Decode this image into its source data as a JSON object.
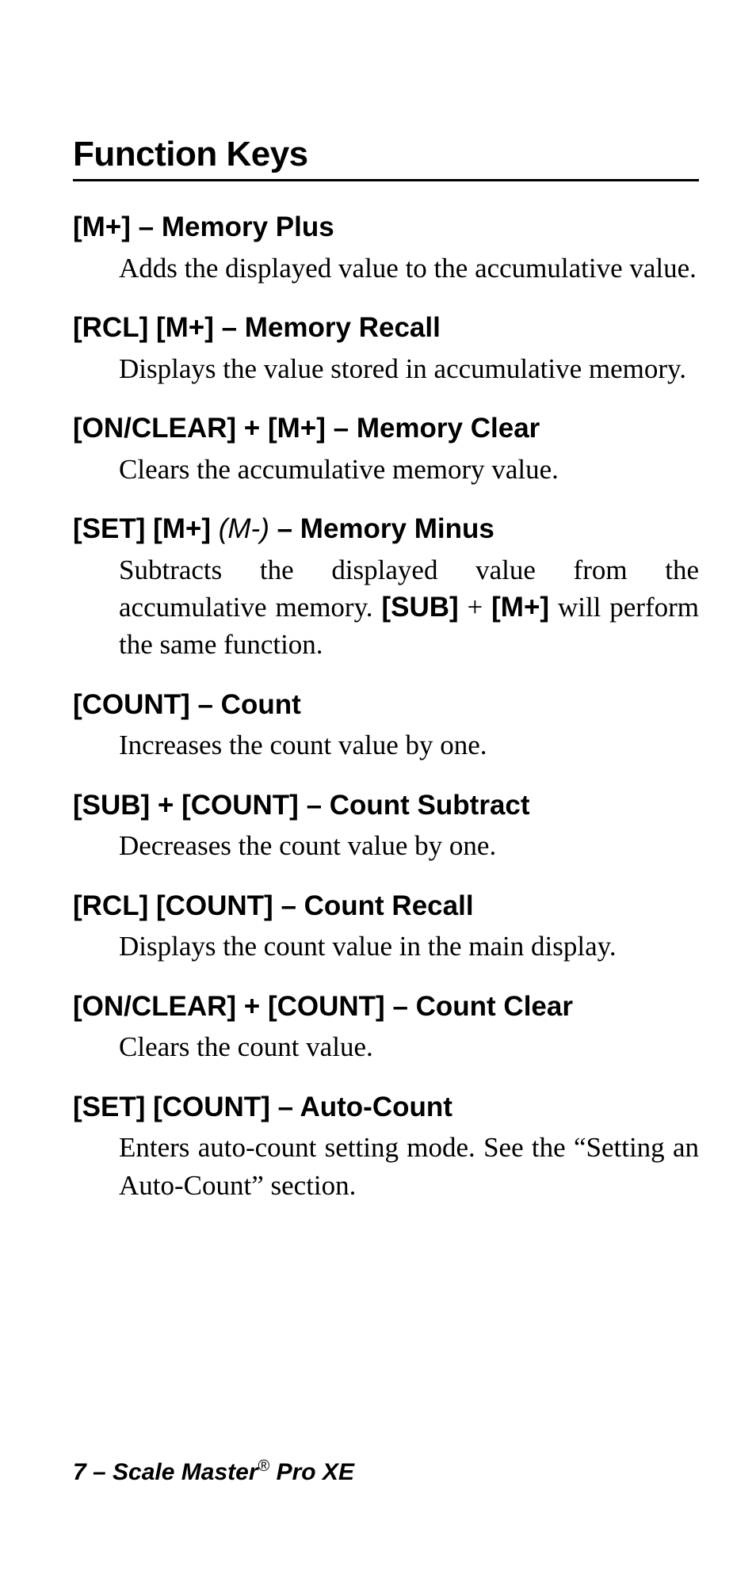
{
  "title": "Function Keys",
  "entries": [
    {
      "key": "[M+]",
      "name": "Memory Plus",
      "desc_pre": "Adds the displayed value to the accumulative value."
    },
    {
      "key": "[RCL] [M+]",
      "name": "Memory Recall",
      "desc_pre": "Displays the value stored in accumulative memory."
    },
    {
      "key": "[ON/CLEAR] + [M+]",
      "name": "Memory Clear",
      "desc_pre": "Clears the accumulative memory value."
    },
    {
      "key": "[SET] [M+]",
      "ital": "(M-)",
      "name": "Memory Minus",
      "desc_pre": "Subtracts the displayed value from the accumulative memory. ",
      "inline_bold1": "[SUB]",
      "inline_mid": " + ",
      "inline_bold2": "[M+]",
      "desc_post": " will perform the same function."
    },
    {
      "key": "[COUNT]",
      "name": "Count",
      "desc_pre": "Increases the count value by one."
    },
    {
      "key": "[SUB] + [COUNT]",
      "name": "Count Subtract",
      "desc_pre": "Decreases the count value by one."
    },
    {
      "key": "[RCL] [COUNT]",
      "name": "Count Recall",
      "desc_pre": "Displays the count value in the main display."
    },
    {
      "key": "[ON/CLEAR] + [COUNT]",
      "name": "Count Clear",
      "desc_pre": "Clears the count value."
    },
    {
      "key": "[SET] [COUNT]",
      "name": "Auto-Count",
      "desc_pre": "Enters auto-count setting mode. See the “Setting an Auto-Count” section."
    }
  ],
  "footer": {
    "page": "7",
    "sep": " – ",
    "product_pre": "Scale Master",
    "reg": "®",
    "product_post": " Pro XE"
  }
}
